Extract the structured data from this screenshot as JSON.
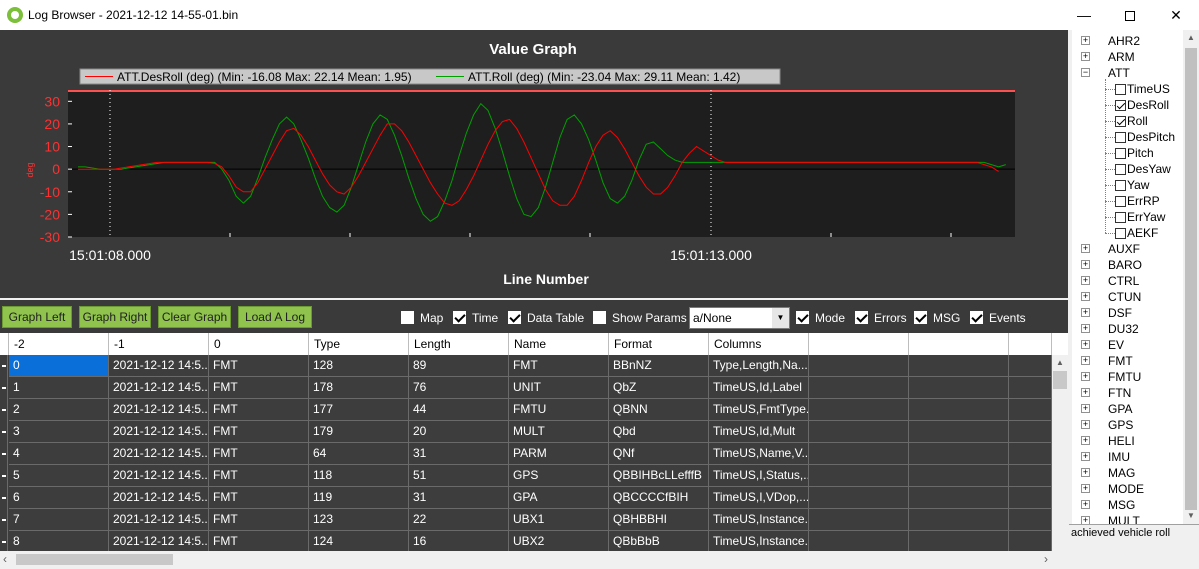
{
  "window": {
    "title": "Log Browser - 2021-12-12 14-55-01.bin",
    "minimize_glyph": "—",
    "close_glyph": "✕"
  },
  "graph": {
    "title": "Value Graph",
    "xlabel": "Line Number",
    "ylabel": "deg",
    "time_labels": [
      "15:01:08.000",
      "15:01:13.000"
    ],
    "legend": [
      {
        "label": "ATT.DesRoll (deg) (Min: -16.08 Max: 22.14 Mean: 1.95)",
        "color": "#ff0000"
      },
      {
        "label": "ATT.Roll (deg) (Min: -23.04 Max: 29.11 Mean: 1.42)",
        "color": "#00a000"
      }
    ]
  },
  "chart_data": {
    "type": "line",
    "title": "Value Graph",
    "xlabel": "Line Number",
    "ylabel": "deg",
    "ylim": [
      -30,
      35
    ],
    "yticks": [
      -30,
      -20,
      -10,
      0,
      10,
      20,
      30
    ],
    "x_tick_labels": [
      "15:01:08.000",
      "15:01:13.000"
    ],
    "x": [
      0,
      1,
      2,
      3,
      4,
      5,
      6,
      7,
      8,
      9,
      10,
      11,
      12,
      13,
      14,
      15,
      16,
      17,
      18,
      19,
      20,
      21,
      22,
      23,
      24,
      25,
      26,
      27,
      28,
      29,
      30,
      31,
      32,
      33,
      34,
      35,
      36,
      37,
      38,
      39,
      40,
      41,
      42,
      43,
      44,
      45,
      46,
      47,
      48,
      49,
      50,
      51,
      52,
      53,
      54,
      55,
      56,
      57,
      58,
      59,
      60,
      61,
      62,
      63,
      64,
      65,
      66,
      67,
      68,
      69,
      70,
      71,
      72,
      73,
      74,
      75,
      76,
      77,
      78,
      79,
      80,
      81,
      82,
      83,
      84,
      85,
      86,
      87,
      88,
      89,
      90,
      91,
      92,
      93,
      94,
      95,
      96,
      97,
      98,
      99,
      100,
      101,
      102,
      103,
      104,
      105,
      106,
      107,
      108,
      109,
      110,
      111,
      112,
      113,
      114,
      115,
      116,
      117,
      118,
      119,
      120,
      121,
      122,
      123,
      124,
      125,
      126,
      127,
      128,
      129,
      130
    ],
    "series": [
      {
        "name": "ATT.DesRoll (deg) (Min: -16.08 Max: 22.14 Mean: 1.95)",
        "color": "#ff0000",
        "values": [
          0,
          0,
          0,
          0,
          0,
          0,
          0.5,
          1,
          1.5,
          2,
          2.5,
          3,
          3,
          3,
          3,
          3,
          3,
          3,
          3,
          2.5,
          1,
          -3,
          -8,
          -10,
          -10,
          -6,
          0,
          6,
          12,
          17,
          18,
          15,
          10,
          4,
          -2,
          -7,
          -10,
          -11,
          -8,
          -3,
          3,
          9,
          15,
          20,
          20,
          17,
          12,
          6,
          0,
          -6,
          -11,
          -15,
          -16,
          -14,
          -9,
          -3,
          4,
          11,
          17,
          21,
          22,
          18,
          12,
          5,
          -2,
          -9,
          -14,
          -16,
          -16,
          -12,
          -5,
          3,
          10,
          15,
          17,
          14,
          9,
          3,
          -3,
          -8,
          -11,
          -11,
          -8,
          -3,
          3,
          7,
          10,
          8,
          6,
          4,
          3,
          3,
          3,
          3,
          3,
          3,
          3,
          3,
          3,
          3,
          3,
          3,
          3,
          3,
          3,
          3,
          3,
          3,
          3,
          3,
          3,
          3,
          3,
          3,
          3,
          3,
          3,
          3,
          3,
          3,
          3,
          3,
          3,
          3,
          3,
          3,
          2,
          1,
          -1
        ]
      },
      {
        "name": "ATT.Roll (deg) (Min: -23.04 Max: 29.11 Mean: 1.42)",
        "color": "#00a000",
        "values": [
          1,
          1,
          0.5,
          0,
          0,
          0,
          0,
          0.5,
          1,
          1.5,
          2,
          2.5,
          3,
          3,
          3,
          3,
          3,
          3,
          3,
          3,
          0,
          -5,
          -12,
          -15,
          -12,
          -4,
          5,
          13,
          20,
          23,
          20,
          13,
          5,
          -4,
          -12,
          -17,
          -19,
          -16,
          -8,
          2,
          12,
          20,
          24,
          22,
          15,
          6,
          -4,
          -13,
          -20,
          -23,
          -21,
          -14,
          -5,
          6,
          16,
          24,
          29,
          26,
          18,
          8,
          -3,
          -13,
          -20,
          -21,
          -17,
          -8,
          3,
          14,
          22,
          24,
          20,
          13,
          4,
          -6,
          -13,
          -15,
          -12,
          -5,
          4,
          11,
          12,
          9,
          6,
          4,
          3,
          3,
          3,
          3,
          3,
          3,
          3,
          3,
          3,
          3,
          3,
          3,
          3,
          3,
          3,
          3,
          3,
          3,
          3,
          3,
          3,
          3,
          3,
          3,
          3,
          3,
          3,
          3,
          3,
          3,
          3,
          3,
          3,
          3,
          3,
          3,
          3,
          3,
          3,
          3,
          3,
          3,
          3,
          2,
          1,
          2
        ]
      }
    ],
    "grid": false,
    "legend_position": "top"
  },
  "toolbar": {
    "buttons": [
      "Graph Left",
      "Graph Right",
      "Clear Graph",
      "Load A Log"
    ],
    "checks": [
      {
        "label": "Map",
        "checked": false
      },
      {
        "label": "Time",
        "checked": true
      },
      {
        "label": "Data Table",
        "checked": true
      },
      {
        "label": "Show Params",
        "checked": false
      }
    ],
    "combo_value": "a/None",
    "checks2": [
      {
        "label": "Mode",
        "checked": true
      },
      {
        "label": "Errors",
        "checked": true
      },
      {
        "label": "MSG",
        "checked": true
      },
      {
        "label": "Events",
        "checked": true
      }
    ]
  },
  "table": {
    "headers": [
      "-2",
      "-1",
      "0",
      "Type",
      "Length",
      "Name",
      "Format",
      "Columns",
      "",
      "",
      ""
    ],
    "rows": [
      [
        "0",
        "2021-12-12 14:5...",
        "FMT",
        "128",
        "89",
        "FMT",
        "BBnNZ",
        "Type,Length,Na...",
        "",
        "",
        ""
      ],
      [
        "1",
        "2021-12-12 14:5...",
        "FMT",
        "178",
        "76",
        "UNIT",
        "QbZ",
        "TimeUS,Id,Label",
        "",
        "",
        ""
      ],
      [
        "2",
        "2021-12-12 14:5...",
        "FMT",
        "177",
        "44",
        "FMTU",
        "QBNN",
        "TimeUS,FmtType...",
        "",
        "",
        ""
      ],
      [
        "3",
        "2021-12-12 14:5...",
        "FMT",
        "179",
        "20",
        "MULT",
        "Qbd",
        "TimeUS,Id,Mult",
        "",
        "",
        ""
      ],
      [
        "4",
        "2021-12-12 14:5...",
        "FMT",
        "64",
        "31",
        "PARM",
        "QNf",
        "TimeUS,Name,V...",
        "",
        "",
        ""
      ],
      [
        "5",
        "2021-12-12 14:5...",
        "FMT",
        "118",
        "51",
        "GPS",
        "QBBIHBcLLefffB",
        "TimeUS,I,Status,...",
        "",
        "",
        ""
      ],
      [
        "6",
        "2021-12-12 14:5...",
        "FMT",
        "119",
        "31",
        "GPA",
        "QBCCCCfBIH",
        "TimeUS,I,VDop,...",
        "",
        "",
        ""
      ],
      [
        "7",
        "2021-12-12 14:5...",
        "FMT",
        "123",
        "22",
        "UBX1",
        "QBHBBHI",
        "TimeUS,Instance...",
        "",
        "",
        ""
      ],
      [
        "8",
        "2021-12-12 14:5...",
        "FMT",
        "124",
        "16",
        "UBX2",
        "QBbBbB",
        "TimeUS,Instance...",
        "",
        "",
        ""
      ]
    ]
  },
  "tree": {
    "items": [
      {
        "label": "AHR2",
        "kind": "group",
        "expanded": false
      },
      {
        "label": "ARM",
        "kind": "group",
        "expanded": false
      },
      {
        "label": "ATT",
        "kind": "group",
        "expanded": true
      },
      {
        "label": "TimeUS",
        "kind": "field",
        "checked": false
      },
      {
        "label": "DesRoll",
        "kind": "field",
        "checked": true
      },
      {
        "label": "Roll",
        "kind": "field",
        "checked": true
      },
      {
        "label": "DesPitch",
        "kind": "field",
        "checked": false
      },
      {
        "label": "Pitch",
        "kind": "field",
        "checked": false
      },
      {
        "label": "DesYaw",
        "kind": "field",
        "checked": false
      },
      {
        "label": "Yaw",
        "kind": "field",
        "checked": false
      },
      {
        "label": "ErrRP",
        "kind": "field",
        "checked": false
      },
      {
        "label": "ErrYaw",
        "kind": "field",
        "checked": false
      },
      {
        "label": "AEKF",
        "kind": "field",
        "checked": false
      },
      {
        "label": "AUXF",
        "kind": "group",
        "expanded": false
      },
      {
        "label": "BARO",
        "kind": "group",
        "expanded": false
      },
      {
        "label": "CTRL",
        "kind": "group",
        "expanded": false
      },
      {
        "label": "CTUN",
        "kind": "group",
        "expanded": false
      },
      {
        "label": "DSF",
        "kind": "group",
        "expanded": false
      },
      {
        "label": "DU32",
        "kind": "group",
        "expanded": false
      },
      {
        "label": "EV",
        "kind": "group",
        "expanded": false
      },
      {
        "label": "FMT",
        "kind": "group",
        "expanded": false
      },
      {
        "label": "FMTU",
        "kind": "group",
        "expanded": false
      },
      {
        "label": "FTN",
        "kind": "group",
        "expanded": false
      },
      {
        "label": "GPA",
        "kind": "group",
        "expanded": false
      },
      {
        "label": "GPS",
        "kind": "group",
        "expanded": false
      },
      {
        "label": "HELI",
        "kind": "group",
        "expanded": false
      },
      {
        "label": "IMU",
        "kind": "group",
        "expanded": false
      },
      {
        "label": "MAG",
        "kind": "group",
        "expanded": false
      },
      {
        "label": "MODE",
        "kind": "group",
        "expanded": false
      },
      {
        "label": "MSG",
        "kind": "group",
        "expanded": false
      },
      {
        "label": "MULT",
        "kind": "group",
        "expanded": false
      }
    ],
    "description": "achieved vehicle roll"
  }
}
